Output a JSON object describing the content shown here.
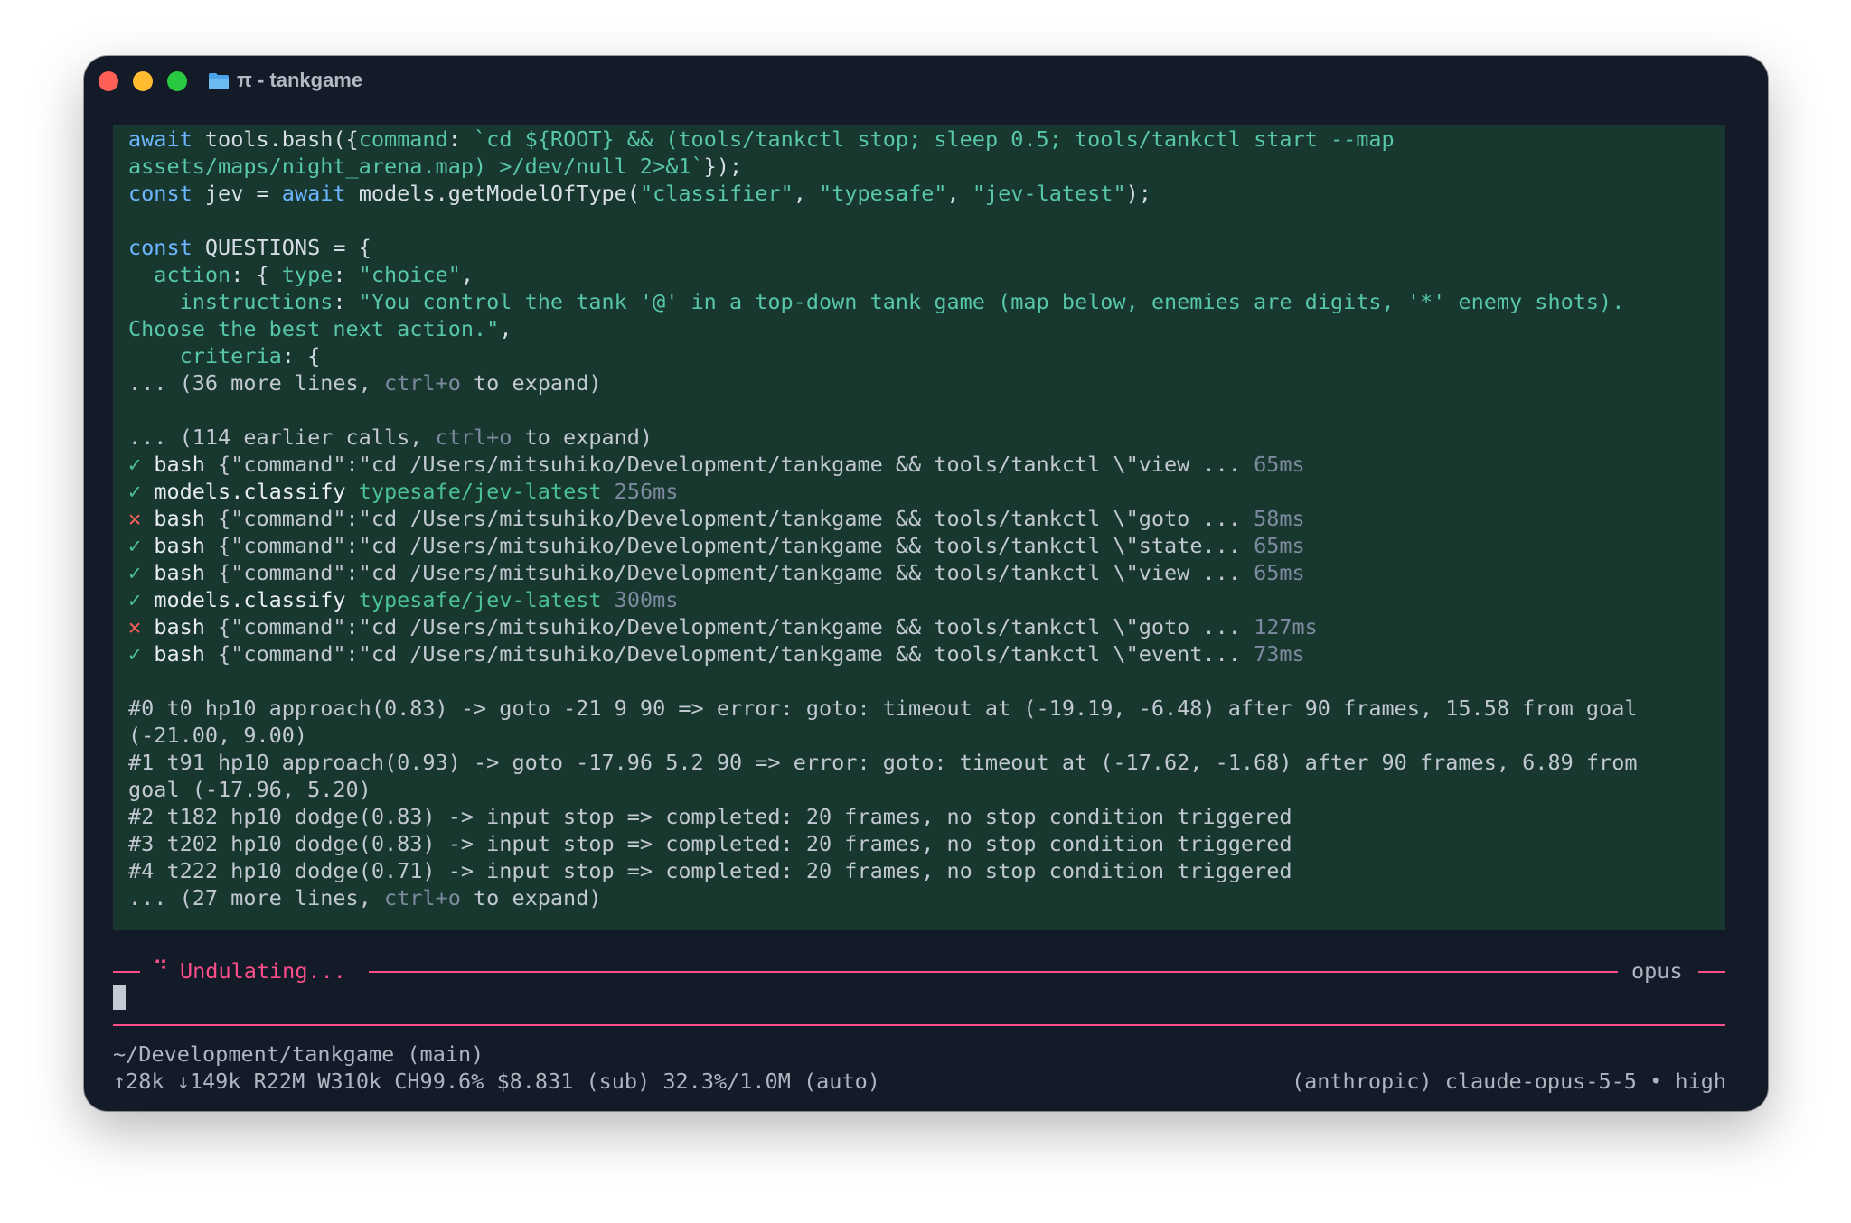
{
  "window": {
    "title": "π - tankgame"
  },
  "code": {
    "line1_kw": "await",
    "line1_a": " tools.bash({",
    "line1_prop": "command",
    "line1_b": ": ",
    "line1_str": "`cd ${ROOT} && (tools/tankctl stop; sleep 0.5; tools/tankctl start --map",
    "line2_str": "assets/maps/night_arena.map) >/dev/null 2>&1`",
    "line2_b": "});",
    "line3_kw": "const",
    "line3_a": " jev = ",
    "line3_kw2": "await",
    "line3_b": " models.getModelOfType(",
    "line3_s1": "\"classifier\"",
    "line3_c": ", ",
    "line3_s2": "\"typesafe\"",
    "line3_d": ", ",
    "line3_s3": "\"jev-latest\"",
    "line3_e": ");",
    "line5_kw": "const",
    "line5_a": " QUESTIONS = {",
    "line6_prop": "action",
    "line6_a": ": { ",
    "line6_prop2": "type",
    "line6_b": ": ",
    "line6_str": "\"choice\"",
    "line6_c": ",",
    "line7_prop": "instructions",
    "line7_a": ": ",
    "line7_str": "\"You control the tank '@' in a top-down tank game (map below, enemies are digits, '*' enemy shots).",
    "line8_str": "Choose the best next action.\"",
    "line8_a": ",",
    "line9_prop": "criteria",
    "line9_a": ": {",
    "more1_a": "... (36 more lines, ",
    "more1_key": "ctrl+o",
    "more1_b": " to expand)"
  },
  "calls": {
    "earlier_a": "... (114 earlier calls, ",
    "earlier_key": "ctrl+o",
    "earlier_b": " to expand)",
    "items": [
      {
        "mark": "✓",
        "name": "bash",
        "args": " {\"command\":\"cd /Users/mitsuhiko/Development/tankgame && tools/tankctl \\\"view ... ",
        "time": "65ms"
      },
      {
        "mark": "✓",
        "name": "models.classify",
        "args": " typesafe/jev-latest ",
        "time": "256ms"
      },
      {
        "mark": "✕",
        "name": "bash",
        "args": " {\"command\":\"cd /Users/mitsuhiko/Development/tankgame && tools/tankctl \\\"goto ... ",
        "time": "58ms"
      },
      {
        "mark": "✓",
        "name": "bash",
        "args": " {\"command\":\"cd /Users/mitsuhiko/Development/tankgame && tools/tankctl \\\"state... ",
        "time": "65ms"
      },
      {
        "mark": "✓",
        "name": "bash",
        "args": " {\"command\":\"cd /Users/mitsuhiko/Development/tankgame && tools/tankctl \\\"view ... ",
        "time": "65ms"
      },
      {
        "mark": "✓",
        "name": "models.classify",
        "args": " typesafe/jev-latest ",
        "time": "300ms"
      },
      {
        "mark": "✕",
        "name": "bash",
        "args": " {\"command\":\"cd /Users/mitsuhiko/Development/tankgame && tools/tankctl \\\"goto ... ",
        "time": "127ms"
      },
      {
        "mark": "✓",
        "name": "bash",
        "args": " {\"command\":\"cd /Users/mitsuhiko/Development/tankgame && tools/tankctl \\\"event... ",
        "time": "73ms"
      }
    ]
  },
  "log": {
    "l1": "#0 t0 hp10 approach(0.83) -> goto -21 9 90 => error: goto: timeout at (-19.19, -6.48) after 90 frames, 15.58 from goal",
    "l2": "(-21.00, 9.00)",
    "l3": "#1 t91 hp10 approach(0.93) -> goto -17.96 5.2 90 => error: goto: timeout at (-17.62, -1.68) after 90 frames, 6.89 from",
    "l4": "goal (-17.96, 5.20)",
    "l5": "#2 t182 hp10 dodge(0.83) -> input stop => completed: 20 frames, no stop condition triggered",
    "l6": "#3 t202 hp10 dodge(0.83) -> input stop => completed: 20 frames, no stop condition triggered",
    "l7": "#4 t222 hp10 dodge(0.71) -> input stop => completed: 20 frames, no stop condition triggered",
    "more_a": "... (27 more lines, ",
    "more_key": "ctrl+o",
    "more_b": " to expand)"
  },
  "spinner": {
    "glyph": "⠙",
    "label": "Undulating...",
    "model_tag": "opus"
  },
  "status": {
    "cwd": "~/Development/tankgame (main)",
    "usage": "↑28k ↓149k R22M W310k CH99.6% $8.831 (sub) 32.3%/1.0M (auto)",
    "model": "(anthropic) claude-opus-5-5 • high"
  },
  "colors": {
    "accent": "#ff4f8b",
    "panel": "#18372f",
    "background": "#141b28"
  }
}
